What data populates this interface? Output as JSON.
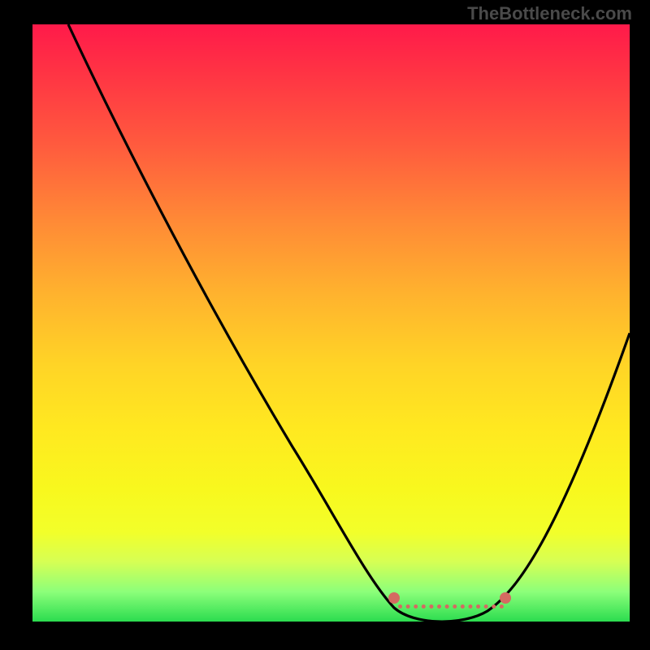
{
  "attribution": "TheBottleneck.com",
  "colors": {
    "attribution_text": "#4a4a4a",
    "curve_stroke": "#000000",
    "marker_fill": "#d46a61",
    "frame_bg": "#000000"
  },
  "chart_data": {
    "type": "line",
    "title": "",
    "xlabel": "",
    "ylabel": "",
    "xlim": [
      0,
      100
    ],
    "ylim": [
      0,
      100
    ],
    "curve_points": [
      {
        "x": 6,
        "y": 100
      },
      {
        "x": 14,
        "y": 85
      },
      {
        "x": 22,
        "y": 70
      },
      {
        "x": 31,
        "y": 55
      },
      {
        "x": 41,
        "y": 38
      },
      {
        "x": 51,
        "y": 20
      },
      {
        "x": 56,
        "y": 10
      },
      {
        "x": 60,
        "y": 4
      },
      {
        "x": 64,
        "y": 1
      },
      {
        "x": 70,
        "y": 0
      },
      {
        "x": 76,
        "y": 1
      },
      {
        "x": 80,
        "y": 4
      },
      {
        "x": 86,
        "y": 14
      },
      {
        "x": 92,
        "y": 28
      },
      {
        "x": 100,
        "y": 48
      }
    ],
    "markers": [
      {
        "x": 61,
        "y": 5
      },
      {
        "x": 79,
        "y": 5
      }
    ],
    "flat_segment": {
      "x1": 62,
      "x2": 78,
      "y": 3
    },
    "background_gradient": {
      "top": "#ff1a4a",
      "mid": "#ffd426",
      "bottom": "#2bdc4f"
    }
  }
}
